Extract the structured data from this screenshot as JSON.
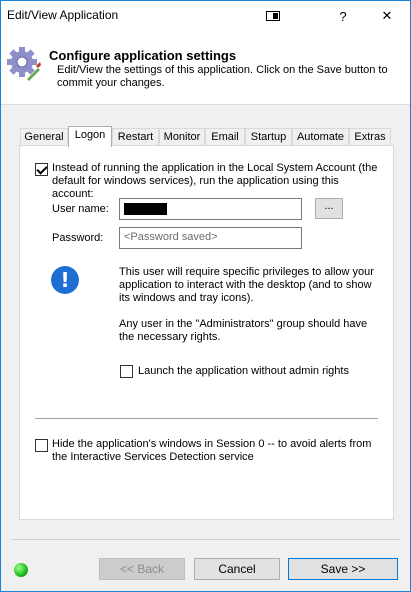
{
  "window": {
    "title": "Edit/View Application",
    "help_label": "?",
    "close_label": "✕"
  },
  "header": {
    "title": "Configure application settings",
    "subtitle": "Edit/View the settings of this application. Click on the Save button to commit your changes."
  },
  "tabs": [
    {
      "label": "General",
      "active": false
    },
    {
      "label": "Logon",
      "active": true
    },
    {
      "label": "Restart",
      "active": false
    },
    {
      "label": "Monitor",
      "active": false
    },
    {
      "label": "Email",
      "active": false
    },
    {
      "label": "Startup",
      "active": false
    },
    {
      "label": "Automate",
      "active": false
    },
    {
      "label": "Extras",
      "active": false
    }
  ],
  "logon": {
    "run_as_label": "Instead of running the application in the Local System Account (the default for windows services), run the application using this account:",
    "run_as_checked": true,
    "username_label": "User name:",
    "browse_label": "...",
    "password_label": "Password:",
    "password_placeholder": "<Password saved>",
    "info_text_1": "This user will require specific privileges to allow your application to interact with the desktop (and to show its windows and tray icons).",
    "info_text_2": "Any user in the \"Administrators\" group should have the necessary rights.",
    "launch_no_admin_label": "Launch the application without admin rights",
    "launch_no_admin_checked": false,
    "hide_session0_label": "Hide the application's windows in Session 0 -- to avoid alerts from the Interactive Services Detection service",
    "hide_session0_checked": false
  },
  "footer": {
    "back_label": "<< Back",
    "cancel_label": "Cancel",
    "save_label": "Save >>",
    "status_color": "#1fb91a"
  },
  "colors": {
    "accent": "#1883d7",
    "info_blue": "#1f6ed4"
  }
}
